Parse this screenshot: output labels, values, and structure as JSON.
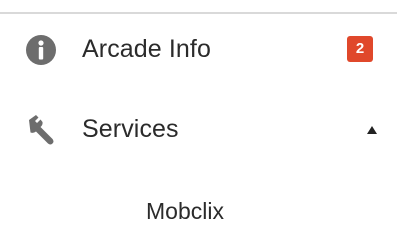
{
  "menu": {
    "items": [
      {
        "label": "Arcade Info",
        "icon": "info-circle-icon",
        "badge": "2",
        "badge_color": "#e0482b"
      },
      {
        "label": "Services",
        "icon": "wrench-icon",
        "expanded": true,
        "caret": "up",
        "submenu": [
          {
            "label": "Mobclix"
          }
        ]
      }
    ]
  },
  "colors": {
    "icon": "#6d6d6d",
    "text": "#2b2b2b",
    "divider": "#d9d9d9",
    "caret": "#222222"
  }
}
